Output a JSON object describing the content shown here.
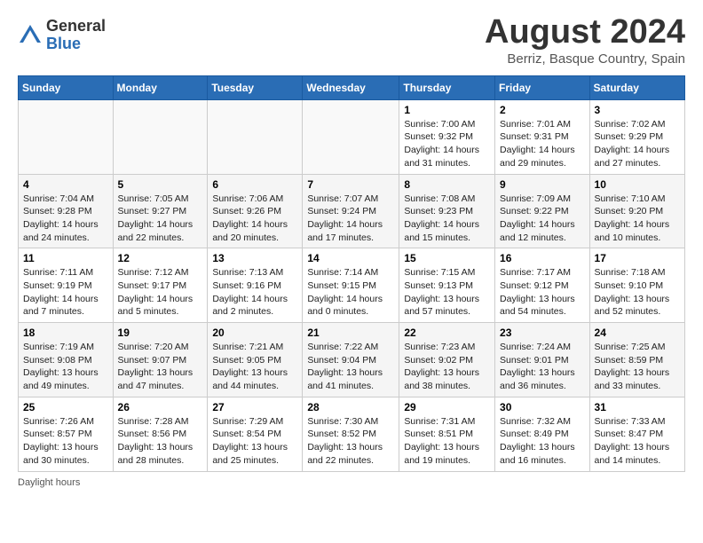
{
  "header": {
    "logo_general": "General",
    "logo_blue": "Blue",
    "month_title": "August 2024",
    "location": "Berriz, Basque Country, Spain"
  },
  "calendar": {
    "weekdays": [
      "Sunday",
      "Monday",
      "Tuesday",
      "Wednesday",
      "Thursday",
      "Friday",
      "Saturday"
    ],
    "weeks": [
      [
        {
          "day": "",
          "detail": ""
        },
        {
          "day": "",
          "detail": ""
        },
        {
          "day": "",
          "detail": ""
        },
        {
          "day": "",
          "detail": ""
        },
        {
          "day": "1",
          "detail": "Sunrise: 7:00 AM\nSunset: 9:32 PM\nDaylight: 14 hours and 31 minutes."
        },
        {
          "day": "2",
          "detail": "Sunrise: 7:01 AM\nSunset: 9:31 PM\nDaylight: 14 hours and 29 minutes."
        },
        {
          "day": "3",
          "detail": "Sunrise: 7:02 AM\nSunset: 9:29 PM\nDaylight: 14 hours and 27 minutes."
        }
      ],
      [
        {
          "day": "4",
          "detail": "Sunrise: 7:04 AM\nSunset: 9:28 PM\nDaylight: 14 hours and 24 minutes."
        },
        {
          "day": "5",
          "detail": "Sunrise: 7:05 AM\nSunset: 9:27 PM\nDaylight: 14 hours and 22 minutes."
        },
        {
          "day": "6",
          "detail": "Sunrise: 7:06 AM\nSunset: 9:26 PM\nDaylight: 14 hours and 20 minutes."
        },
        {
          "day": "7",
          "detail": "Sunrise: 7:07 AM\nSunset: 9:24 PM\nDaylight: 14 hours and 17 minutes."
        },
        {
          "day": "8",
          "detail": "Sunrise: 7:08 AM\nSunset: 9:23 PM\nDaylight: 14 hours and 15 minutes."
        },
        {
          "day": "9",
          "detail": "Sunrise: 7:09 AM\nSunset: 9:22 PM\nDaylight: 14 hours and 12 minutes."
        },
        {
          "day": "10",
          "detail": "Sunrise: 7:10 AM\nSunset: 9:20 PM\nDaylight: 14 hours and 10 minutes."
        }
      ],
      [
        {
          "day": "11",
          "detail": "Sunrise: 7:11 AM\nSunset: 9:19 PM\nDaylight: 14 hours and 7 minutes."
        },
        {
          "day": "12",
          "detail": "Sunrise: 7:12 AM\nSunset: 9:17 PM\nDaylight: 14 hours and 5 minutes."
        },
        {
          "day": "13",
          "detail": "Sunrise: 7:13 AM\nSunset: 9:16 PM\nDaylight: 14 hours and 2 minutes."
        },
        {
          "day": "14",
          "detail": "Sunrise: 7:14 AM\nSunset: 9:15 PM\nDaylight: 14 hours and 0 minutes."
        },
        {
          "day": "15",
          "detail": "Sunrise: 7:15 AM\nSunset: 9:13 PM\nDaylight: 13 hours and 57 minutes."
        },
        {
          "day": "16",
          "detail": "Sunrise: 7:17 AM\nSunset: 9:12 PM\nDaylight: 13 hours and 54 minutes."
        },
        {
          "day": "17",
          "detail": "Sunrise: 7:18 AM\nSunset: 9:10 PM\nDaylight: 13 hours and 52 minutes."
        }
      ],
      [
        {
          "day": "18",
          "detail": "Sunrise: 7:19 AM\nSunset: 9:08 PM\nDaylight: 13 hours and 49 minutes."
        },
        {
          "day": "19",
          "detail": "Sunrise: 7:20 AM\nSunset: 9:07 PM\nDaylight: 13 hours and 47 minutes."
        },
        {
          "day": "20",
          "detail": "Sunrise: 7:21 AM\nSunset: 9:05 PM\nDaylight: 13 hours and 44 minutes."
        },
        {
          "day": "21",
          "detail": "Sunrise: 7:22 AM\nSunset: 9:04 PM\nDaylight: 13 hours and 41 minutes."
        },
        {
          "day": "22",
          "detail": "Sunrise: 7:23 AM\nSunset: 9:02 PM\nDaylight: 13 hours and 38 minutes."
        },
        {
          "day": "23",
          "detail": "Sunrise: 7:24 AM\nSunset: 9:01 PM\nDaylight: 13 hours and 36 minutes."
        },
        {
          "day": "24",
          "detail": "Sunrise: 7:25 AM\nSunset: 8:59 PM\nDaylight: 13 hours and 33 minutes."
        }
      ],
      [
        {
          "day": "25",
          "detail": "Sunrise: 7:26 AM\nSunset: 8:57 PM\nDaylight: 13 hours and 30 minutes."
        },
        {
          "day": "26",
          "detail": "Sunrise: 7:28 AM\nSunset: 8:56 PM\nDaylight: 13 hours and 28 minutes."
        },
        {
          "day": "27",
          "detail": "Sunrise: 7:29 AM\nSunset: 8:54 PM\nDaylight: 13 hours and 25 minutes."
        },
        {
          "day": "28",
          "detail": "Sunrise: 7:30 AM\nSunset: 8:52 PM\nDaylight: 13 hours and 22 minutes."
        },
        {
          "day": "29",
          "detail": "Sunrise: 7:31 AM\nSunset: 8:51 PM\nDaylight: 13 hours and 19 minutes."
        },
        {
          "day": "30",
          "detail": "Sunrise: 7:32 AM\nSunset: 8:49 PM\nDaylight: 13 hours and 16 minutes."
        },
        {
          "day": "31",
          "detail": "Sunrise: 7:33 AM\nSunset: 8:47 PM\nDaylight: 13 hours and 14 minutes."
        }
      ]
    ]
  },
  "footer": {
    "note": "Daylight hours"
  }
}
